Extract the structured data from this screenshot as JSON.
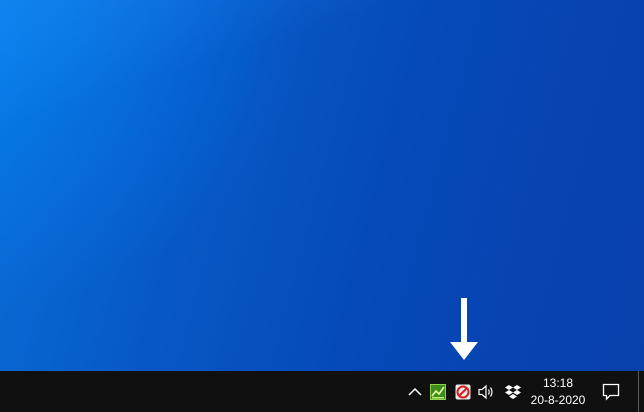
{
  "taskbar": {
    "clock": {
      "time": "13:18",
      "date": "20-8-2020"
    },
    "tray_icons": [
      "chevron-up-icon",
      "app-tray-icon",
      "no-sign-tray-icon",
      "speaker-icon",
      "dropbox-icon"
    ],
    "notification_icon": "notification-icon"
  },
  "annotation": {
    "arrow_icon": "down-arrow-icon",
    "arrow_color": "#ffffff"
  },
  "colors": {
    "desktop_blue": "#0758c6",
    "taskbar_bg": "#101010"
  }
}
